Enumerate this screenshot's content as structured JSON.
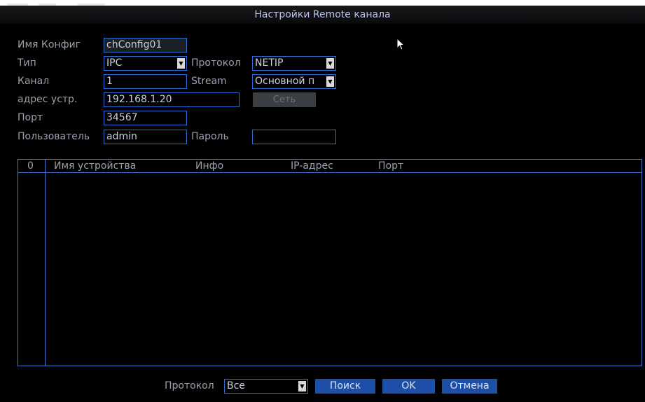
{
  "dialog": {
    "title": "Настройки Remote канала"
  },
  "form": {
    "config_name": {
      "label": "Имя Конфиг",
      "value": "chConfig01"
    },
    "type": {
      "label": "Тип",
      "value": "IPC"
    },
    "protocol": {
      "label": "Протокол",
      "value": "NETIP"
    },
    "channel": {
      "label": "Канал",
      "value": "1"
    },
    "stream": {
      "label": "Stream",
      "value": "Основной п"
    },
    "device_address": {
      "label": "адрес устр.",
      "value": "192.168.1.20"
    },
    "network_button": {
      "label": "Сеть"
    },
    "port": {
      "label": "Порт",
      "value": "34567"
    },
    "user": {
      "label": "Пользователь",
      "value": "admin"
    },
    "password": {
      "label": "Пароль",
      "value": ""
    }
  },
  "table": {
    "columns": [
      "0",
      "Имя устройства",
      "Инфо",
      "IP-адрес",
      "Порт"
    ],
    "rows": []
  },
  "footer": {
    "protocol_label": "Протокол",
    "protocol_value": "Все",
    "search_label": "Поиск",
    "ok_label": "OK",
    "cancel_label": "Отмена"
  },
  "colors": {
    "background": "#000000",
    "field_border": "#2c6fd6",
    "button": "#1d4fa8",
    "label_text": "#9aa0ad"
  }
}
